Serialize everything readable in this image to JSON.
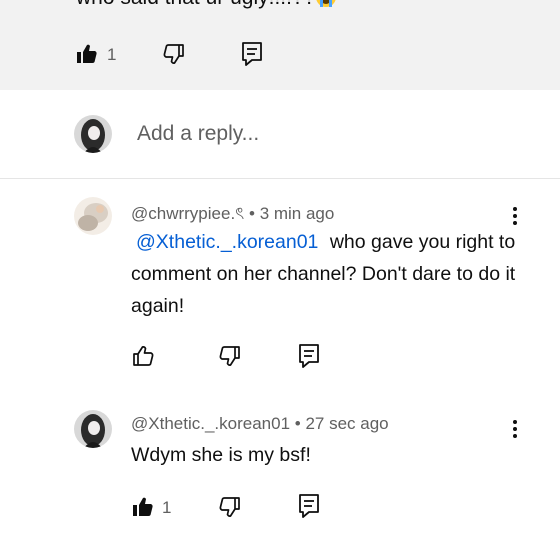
{
  "parent_comment": {
    "text": "who said that ur ugly!!!!??",
    "likes": "1"
  },
  "reply_box": {
    "placeholder": "Add a reply..."
  },
  "replies": [
    {
      "author": "@chwrrypiee.ৎ",
      "separator": "•",
      "time": "3 min ago",
      "mention": "@Xthetic._.korean01",
      "text": "who gave you right to comment on her channel? Don't dare to do it again!",
      "likes": ""
    },
    {
      "author": "@Xthetic._.korean01",
      "separator": "•",
      "time": "27 sec ago",
      "text": "Wdym she is my bsf!",
      "likes": "1"
    }
  ],
  "colors": {
    "link": "#065fd4",
    "meta_text": "#606060",
    "parent_bg": "#f2f2f2"
  },
  "icons": [
    "like-filled-icon",
    "like-outline-icon",
    "dislike-icon",
    "reply-icon",
    "more-vert-icon",
    "crying-emoji"
  ]
}
